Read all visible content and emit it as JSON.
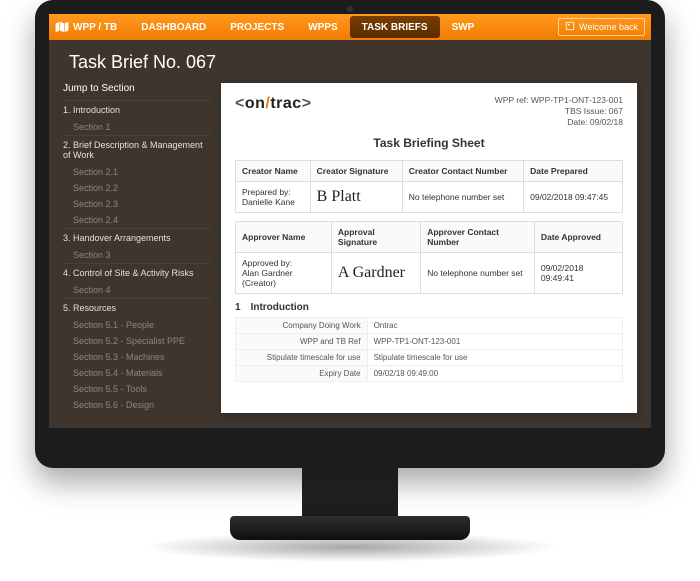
{
  "topbar": {
    "product": "WPP / TB",
    "nav": [
      "DASHBOARD",
      "PROJECTS",
      "WPPS",
      "TASK BRIEFS",
      "SWP"
    ],
    "active_index": 3,
    "welcome": "Welcome back"
  },
  "page_title": "Task Brief No. 067",
  "sidebar": {
    "title": "Jump to Section",
    "sections": [
      {
        "head": "1. Introduction",
        "subs": [
          "Section 1"
        ]
      },
      {
        "head": "2. Brief Description & Management of Work",
        "subs": [
          "Section 2.1",
          "Section 2.2",
          "Section 2.3",
          "Section 2.4"
        ]
      },
      {
        "head": "3. Handover Arrangements",
        "subs": [
          "Section 3"
        ]
      },
      {
        "head": "4. Control of Site & Activity Risks",
        "subs": [
          "Section 4"
        ]
      },
      {
        "head": "5. Resources",
        "subs": [
          "Section 5.1 - People",
          "Section 5.2 - Specialist PPE",
          "Section 5.3 - Machines",
          "Section 5.4 - Materials",
          "Section 5.5 - Tools",
          "Section 5.6 - Design"
        ]
      }
    ]
  },
  "doc": {
    "brand_on": "on",
    "brand_slash": "/",
    "brand_trac": "trac",
    "ref_lines": [
      "WPP ref: WPP-TP1-ONT-123-001",
      "TBS Issue: 067",
      "Date: 09/02/18"
    ],
    "title": "Task Briefing Sheet",
    "creator_table": {
      "headers": [
        "Creator Name",
        "Creator Signature",
        "Creator Contact Number",
        "Date Prepared"
      ],
      "name_prefix": "Prepared by:",
      "name": "Danielle Kane",
      "sig": "B Platt",
      "phone": "No telephone number set",
      "date": "09/02/2018 09:47:45"
    },
    "approver_table": {
      "headers": [
        "Approver Name",
        "Approval Signature",
        "Approver Contact Number",
        "Date Approved"
      ],
      "name_prefix": "Approved by:",
      "name": "Alan Gardner (Creator)",
      "sig": "A Gardner",
      "phone": "No telephone number set",
      "date": "09/02/2018 09:49:41"
    },
    "intro_num": "1",
    "intro_title": "Introduction",
    "kv": [
      [
        "Company Doing Work",
        "Ontrac"
      ],
      [
        "WPP and TB Ref",
        "WPP-TP1-ONT-123-001"
      ],
      [
        "Stipulate timescale for use",
        "Stipulate timescale for use"
      ],
      [
        "Expiry Date",
        "09/02/18 09:49:00"
      ]
    ]
  }
}
